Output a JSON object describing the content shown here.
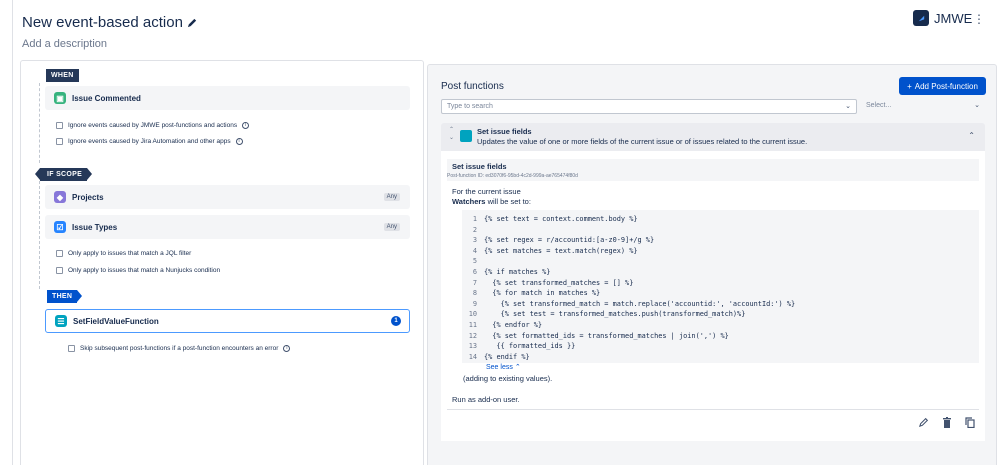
{
  "header": {
    "title": "New event-based action",
    "add_description": "Add a description",
    "brand": "JMWE"
  },
  "left": {
    "when_tag": "WHEN",
    "if_scope_tag": "IF SCOPE",
    "then_tag": "THEN",
    "trigger_card": "Issue Commented",
    "trigger_options": [
      "Ignore events caused by JMWE post-functions and actions",
      "Ignore events caused by Jira Automation and other apps"
    ],
    "scope_cards": [
      {
        "label": "Projects",
        "badge": "Any"
      },
      {
        "label": "Issue Types",
        "badge": "Any"
      }
    ],
    "scope_options": [
      "Only apply to issues that match a JQL filter",
      "Only apply to issues that match a Nunjucks condition"
    ],
    "action_card": "SetFieldValueFunction",
    "action_badge": "1",
    "action_option": "Skip subsequent post-functions if a post-function encounters an error"
  },
  "right": {
    "title": "Post functions",
    "add_button": "Add Post-function",
    "search_placeholder": "Type to search",
    "select_placeholder": "Select...",
    "pf": {
      "name": "Set issue fields",
      "desc": "Updates the value of one or more fields of the current issue or of issues related to the current issue.",
      "sub_title": "Set issue fields",
      "id_text": "Post-function ID: ed3070f6-95bd-4c2d-999a-ae765474f80d",
      "for_current": "For the current issue",
      "watchers_label": "Watchers",
      "watchers_suffix": " will be set to:",
      "see_less": "See less",
      "adding": "(adding to existing values).",
      "run_as": "Run as add-on user."
    }
  },
  "code_lines": [
    "{% set text = context.comment.body %}",
    "",
    "{% set regex = r/accountid:[a-z0-9]+/g %}",
    "{% set matches = text.match(regex) %}",
    "",
    "{% if matches %}",
    "  {% set transformed_matches = [] %}",
    "  {% for match in matches %}",
    "    {% set transformed_match = match.replace('accountid:', 'accountId:') %}",
    "    {% set test = transformed_matches.push(transformed_match)%}",
    "  {% endfor %}",
    "  {% set formatted_ids = transformed_matches | join(',') %}",
    "   {{ formatted_ids }}",
    "{% endif %}"
  ]
}
